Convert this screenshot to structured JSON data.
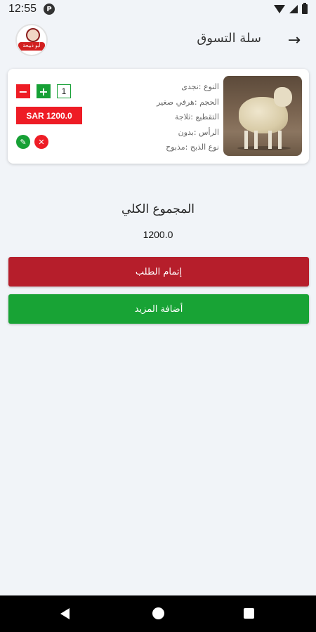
{
  "status_bar": {
    "time": "12:55",
    "notif_glyph": "P"
  },
  "header": {
    "title": "سلة التسوق",
    "back_icon": "→",
    "logo_text": "أبو ذبيحة"
  },
  "cart_item": {
    "details": [
      "النوع :نجدى",
      "الحجم :هرفي صغير",
      "التقطيع :ثلاجة",
      "الرأس :بدون",
      "نوع الذبح :مذبوح"
    ],
    "image_icon": "sheep-photo",
    "quantity": "1",
    "minus_label": "−",
    "plus_label": "+",
    "price": "SAR 1200.0",
    "edit_glyph": "✎",
    "delete_glyph": "✕"
  },
  "total": {
    "label": "المجموع الكلي",
    "value": "1200.0"
  },
  "buttons": {
    "checkout": "إتمام الطلب",
    "add_more": "أضافة المزيد"
  },
  "colors": {
    "checkout": "#b61e2b",
    "add_more": "#18a335",
    "price_badge": "#ee1c25",
    "plus": "#16a035"
  }
}
